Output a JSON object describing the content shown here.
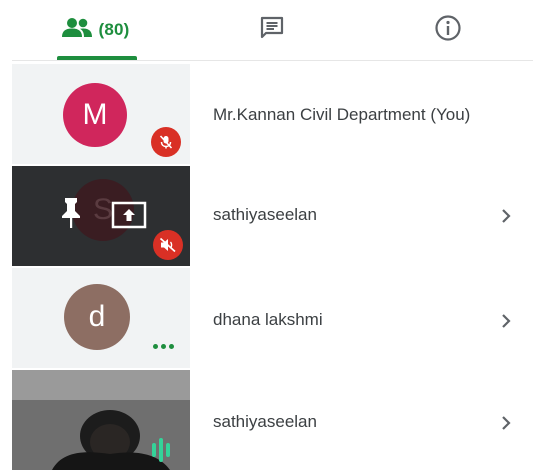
{
  "tabs": [
    {
      "id": "people",
      "icon": "people-icon",
      "count_label": "(80)"
    },
    {
      "id": "chat",
      "icon": "chat-icon"
    },
    {
      "id": "info",
      "icon": "info-icon"
    }
  ],
  "participants": [
    {
      "name": "Mr.Kannan Civil Department (You)",
      "avatar_letter": "M",
      "avatar_color": "#d0265c",
      "status": "muted-mic"
    },
    {
      "name": "sathiyaseelan",
      "avatar_letter": "S",
      "status": "muted-sound",
      "tile": "dark",
      "overlay_icons": [
        "pin-icon",
        "screen-share-icon"
      ]
    },
    {
      "name": "dhana lakshmi",
      "avatar_letter": "d",
      "avatar_color": "#8d6e63",
      "status": "more"
    },
    {
      "name": "sathiyaseelan",
      "status": "speaking",
      "tile": "video"
    }
  ],
  "colors": {
    "accent_green": "#1e8e3e",
    "mute_red": "#d93025"
  }
}
